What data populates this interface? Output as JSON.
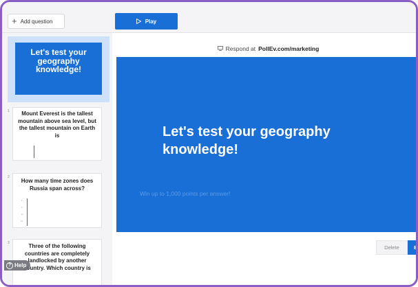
{
  "toolbar": {
    "add_question_label": "Add question",
    "play_label": "Play"
  },
  "sidebar": {
    "slides": [
      {
        "number": "",
        "title": "Let's test your geography knowledge!",
        "active": true
      },
      {
        "number": "1",
        "title": "Mount Everest is the tallest mountain above sea level, but the tallest mountain on Earth is"
      },
      {
        "number": "2",
        "title": "How many time zones does Russia span across?",
        "chart_labels": [
          "6",
          "9",
          "11",
          "13"
        ]
      },
      {
        "number": "3",
        "title": "Three of the following countries are completely landlocked by another country. Which country is"
      }
    ],
    "help_label": "Help"
  },
  "preview": {
    "respond_prefix": "Respond at",
    "respond_url": "PollEv.com/marketing",
    "slide_title": "Let's test your geography knowledge!",
    "slide_subtitle": "Win up to 1,000 points per answer!"
  },
  "actions": {
    "delete_label": "Delete",
    "edit_label": "Edit"
  },
  "colors": {
    "accent": "#1a6fd6",
    "frame": "#8a5cc6",
    "active_thumb_bg": "#cde2fa"
  }
}
